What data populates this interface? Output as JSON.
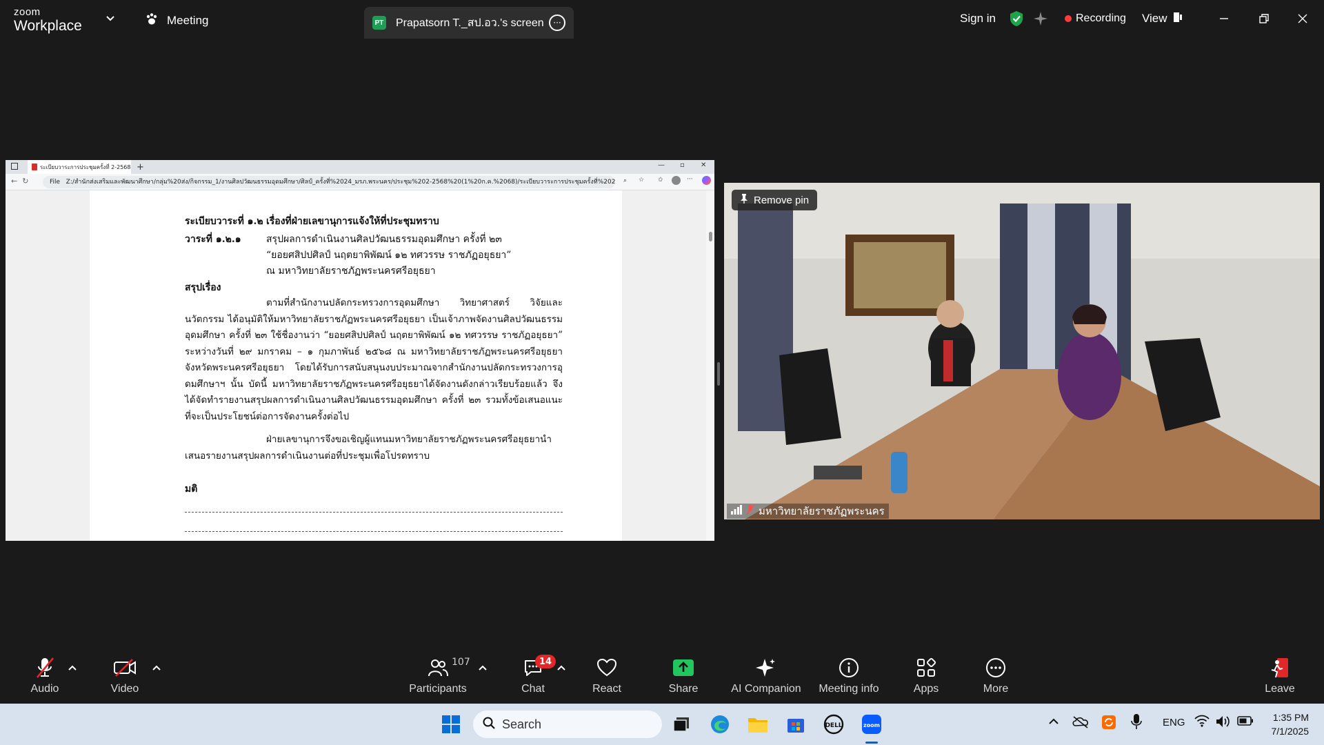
{
  "app": {
    "brand_top": "zoom",
    "brand_bottom": "Workplace",
    "meeting_tab": "Meeting",
    "screen_tab_badge": "PT",
    "screen_tab_label": "Prapatsorn T._สป.อว.'s screen",
    "sign_in": "Sign in",
    "recording": "Recording",
    "view": "View"
  },
  "browser": {
    "tab_title": "ระเบียบวาระการประชุมครั้งที่ 2-2568.p",
    "url_prefix": "File",
    "url": "Z:/สำนักส่งเสริมและพัฒนาศึกษา/กลุ่ม%20ส่ง/กิจกรรม_1/งานศิลปวัฒนธรรมอุดมศึกษา/ศิลป์_ครั้งที่%2024_มรภ.พระนคร/ประชุม%202-2568%20(1%20ก.ค.%2068)/ระเบียบวาระการประชุมครั้งที่%202-256..."
  },
  "pdf": {
    "heading_label": "ระเบียบวาระที่ ๑.๒",
    "heading_text": "เรื่องที่ฝ่ายเลขานุการแจ้งให้ที่ประชุมทราบ",
    "agenda_label": "วาระที่ ๑.๒.๑",
    "agenda_line1": "สรุปผลการดำเนินงานศิลปวัฒนธรรมอุดมศึกษา ครั้งที่ ๒๓",
    "agenda_line2": "“ยอยศสิปปศิลป์ นฤตยาพิพัฒน์ ๑๒ ทศวรรษ ราชภัฏอยุธยา”",
    "agenda_line3": "ณ มหาวิทยาลัยราชภัฏพระนครศรีอยุธยา",
    "summary_label": "สรุปเรื่อง",
    "para1": "ตามที่สำนักงานปลัดกระทรวงการอุดมศึกษา วิทยาศาสตร์ วิจัยและนวัตกรรม ได้อนุมัติให้มหาวิทยาลัยราชภัฏพระนครศรีอยุธยา เป็นเจ้าภาพจัดงานศิลปวัฒนธรรมอุดมศึกษา ครั้งที่ ๒๓ ใช้ชื่องานว่า “ยอยศสิปปศิลป์ นฤตยาพิพัฒน์ ๑๒ ทศวรรษ ราชภัฏอยุธยา” ระหว่างวันที่ ๒๙ มกราคม – ๑ กุมภาพันธ์ ๒๕๖๘ ณ มหาวิทยาลัยราชภัฏพระนครศรีอยุธยา จังหวัดพระนครศรีอยุธยา โดยได้รับการสนับสนุนงบประมาณจากสำนักงานปลัดกระทรวงการอุดมศึกษาฯ นั้น บัดนี้ มหาวิทยาลัยราชภัฏพระนครศรีอยุธยาได้จัดงานดังกล่าวเรียบร้อยแล้ว จึงได้จัดทำรายงานสรุปผลการดำเนินงานศิลปวัฒนธรรมอุดมศึกษา ครั้งที่ ๒๓ รวมทั้งข้อเสนอแนะที่จะเป็นประโยชน์ต่อการจัดงานครั้งต่อไป",
    "para2": "ฝ่ายเลขานุการจึงขอเชิญผู้แทนมหาวิทยาลัยราชภัฏพระนครศรีอยุธยานำเสนอรายงานสรุปผลการดำเนินงานต่อที่ประชุมเพื่อโปรดทราบ",
    "resolution_label": "มติ"
  },
  "video": {
    "remove_pin": "Remove pin",
    "participant_name": "มหาวิทยาลัยราชภัฏพระนคร"
  },
  "toolbar": {
    "audio": "Audio",
    "video": "Video",
    "participants": "Participants",
    "participants_count": "107",
    "chat": "Chat",
    "chat_badge": "14",
    "react": "React",
    "share": "Share",
    "ai_companion": "AI Companion",
    "meeting_info": "Meeting info",
    "apps": "Apps",
    "more": "More",
    "leave": "Leave"
  },
  "taskbar": {
    "search": "Search",
    "language": "ENG",
    "time": "1:35 PM",
    "date": "7/1/2025"
  },
  "colors": {
    "share_green": "#22c55e",
    "record_red": "#ff3b3b",
    "leave_red": "#e02828",
    "shield_green": "#1fa34a"
  }
}
